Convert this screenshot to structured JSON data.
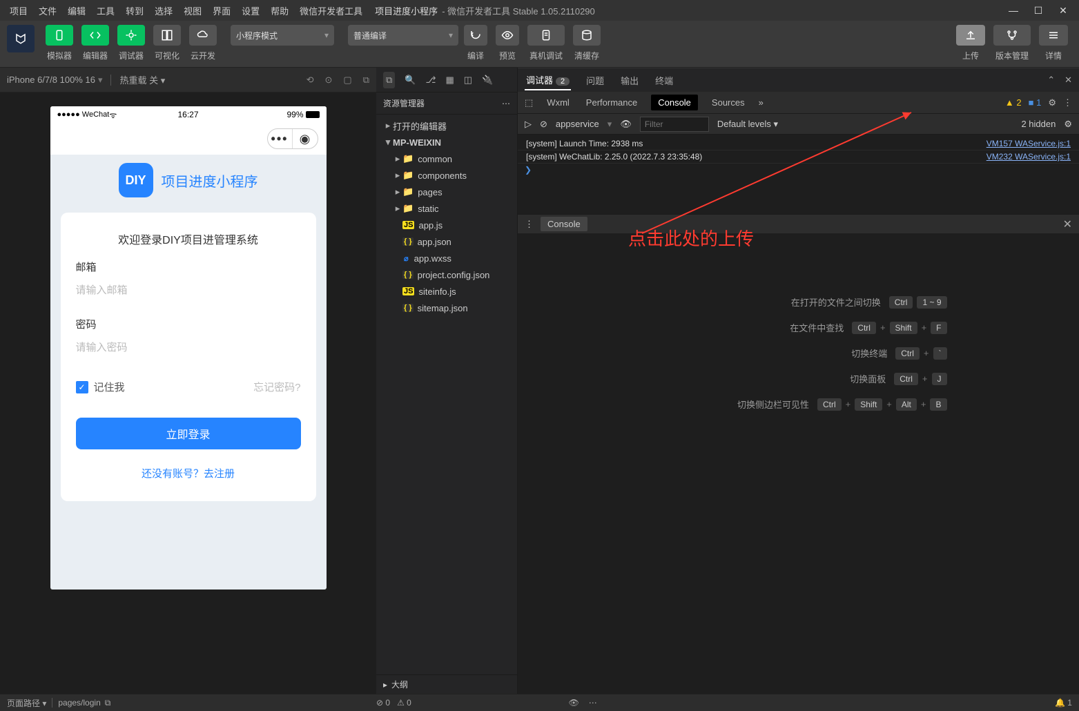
{
  "menus": [
    "项目",
    "文件",
    "编辑",
    "工具",
    "转到",
    "选择",
    "视图",
    "界面",
    "设置",
    "帮助",
    "微信开发者工具"
  ],
  "title": {
    "project": "项目进度小程序",
    "suffix": " - 微信开发者工具 Stable 1.05.2110290"
  },
  "toolbar": {
    "simulator": "模拟器",
    "editor": "编辑器",
    "debugger": "调试器",
    "visual": "可视化",
    "cloud": "云开发",
    "modeSelect": "小程序模式",
    "compileSelect": "普通编译",
    "compile": "编译",
    "preview": "预览",
    "realdev": "真机调试",
    "clearcache": "清缓存",
    "upload": "上传",
    "vcs": "版本管理",
    "details": "详情"
  },
  "sim": {
    "device": "iPhone 6/7/8 100% 16",
    "sep": "▾",
    "hotreload": "热重载 关 ▾",
    "carrier": "●●●●● WeChat",
    "wifi": "📶",
    "time": "16:27",
    "battery": "99%"
  },
  "app": {
    "badge": "DIY",
    "name": "项目进度小程序",
    "welcome": "欢迎登录DIY项目进管理系统",
    "emailLabel": "邮箱",
    "emailPH": "请输入邮箱",
    "pwdLabel": "密码",
    "pwdPH": "请输入密码",
    "remember": "记住我",
    "forgot": "忘记密码?",
    "login": "立即登录",
    "register": "还没有账号？去注册"
  },
  "explorer": {
    "title": "资源管理器",
    "openEditors": "打开的编辑器",
    "project": "MP-WEIXIN",
    "folders": [
      "common",
      "components",
      "pages",
      "static"
    ],
    "files": [
      {
        "name": "app.js",
        "cls": "ic-js",
        "tag": "JS"
      },
      {
        "name": "app.json",
        "cls": "ic-json",
        "tag": "{ }"
      },
      {
        "name": "app.wxss",
        "cls": "ic-wxss",
        "tag": "⌀"
      },
      {
        "name": "project.config.json",
        "cls": "ic-json",
        "tag": "{ }"
      },
      {
        "name": "siteinfo.js",
        "cls": "ic-js",
        "tag": "JS"
      },
      {
        "name": "sitemap.json",
        "cls": "ic-json",
        "tag": "{ }"
      }
    ],
    "outline": "大纲"
  },
  "annotation": "点击此处的上传",
  "shortcuts": [
    {
      "label": "在打开的文件之间切换",
      "keys": [
        "Ctrl",
        "1 ~ 9"
      ]
    },
    {
      "label": "在文件中查找",
      "keys": [
        "Ctrl",
        "+",
        "Shift",
        "+",
        "F"
      ]
    },
    {
      "label": "切换终端",
      "keys": [
        "Ctrl",
        "+",
        "`"
      ]
    },
    {
      "label": "切换面板",
      "keys": [
        "Ctrl",
        "+",
        "J"
      ]
    },
    {
      "label": "切换侧边栏可见性",
      "keys": [
        "Ctrl",
        "+",
        "Shift",
        "+",
        "Alt",
        "+",
        "B"
      ]
    }
  ],
  "debugger": {
    "tabs": {
      "main": "调试器",
      "count": "2",
      "problems": "问题",
      "output": "输出",
      "terminal": "终端"
    },
    "devtabs": [
      "Wxml",
      "Performance",
      "Console",
      "Sources"
    ],
    "warnCount": "2",
    "infoCount": "1",
    "context": "appservice",
    "filterPH": "Filter",
    "levels": "Default levels ▾",
    "hidden": "2 hidden",
    "lines": [
      {
        "text": "[system] Launch Time: 2938 ms",
        "src": "VM157 WAService.js:1"
      },
      {
        "text": "[system] WeChatLib: 2.25.0 (2022.7.3 23:35:48)",
        "src": "VM232 WAService.js:1"
      }
    ],
    "footer": "Console"
  },
  "statusbar": {
    "pathLabel": "页面路径 ▾",
    "path": "pages/login",
    "err": "⊘ 0",
    "warn": "⚠ 0",
    "bell": "🔔 1"
  }
}
